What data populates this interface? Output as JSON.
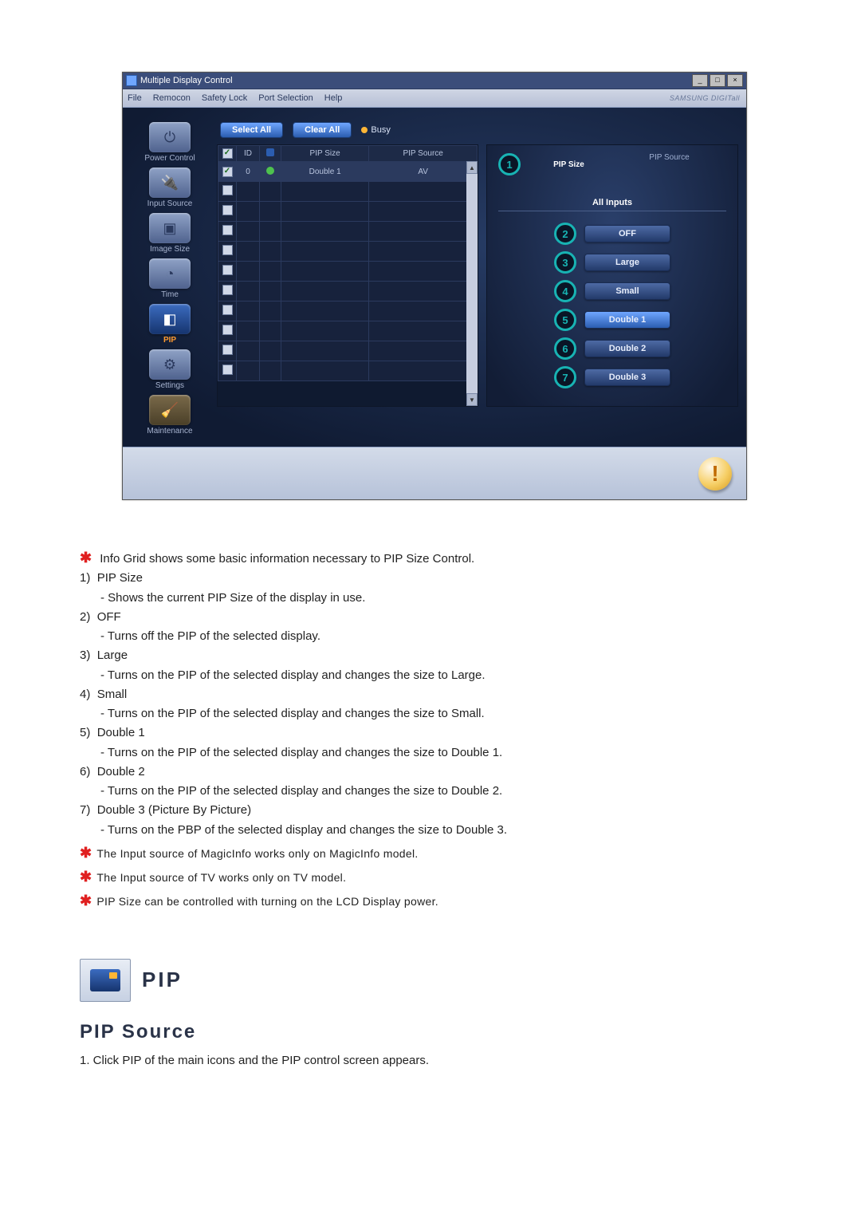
{
  "window": {
    "title": "Multiple Display Control",
    "menus": [
      "File",
      "Remocon",
      "Safety Lock",
      "Port Selection",
      "Help"
    ],
    "brand": "SAMSUNG DIGITall"
  },
  "sidebar": {
    "items": [
      "Power Control",
      "Input Source",
      "Image Size",
      "Time",
      "PIP",
      "Settings",
      "Maintenance"
    ]
  },
  "toolbar": {
    "select_all": "Select All",
    "clear_all": "Clear All",
    "busy": "Busy"
  },
  "grid": {
    "headers": {
      "id": "ID",
      "pip_size": "PIP Size",
      "pip_source": "PIP Source"
    },
    "row": {
      "id": "0",
      "pip_size": "Double 1",
      "pip_source": "AV"
    }
  },
  "panel": {
    "header": {
      "pip_size": "PIP Size",
      "pip_source": "PIP Source"
    },
    "subhead": "All Inputs",
    "options": [
      "OFF",
      "Large",
      "Small",
      "Double 1",
      "Double 2",
      "Double 3"
    ],
    "nums": [
      "1",
      "2",
      "3",
      "4",
      "5",
      "6",
      "7"
    ]
  },
  "doc": {
    "intro": "Info Grid shows some basic information necessary to PIP Size Control.",
    "items": [
      {
        "n": "1)",
        "t": "PIP Size",
        "d": "- Shows the current PIP Size of the display in use."
      },
      {
        "n": "2)",
        "t": "OFF",
        "d": "- Turns off the PIP of the selected display."
      },
      {
        "n": "3)",
        "t": "Large",
        "d": "- Turns on the PIP of the selected display and changes the size to Large."
      },
      {
        "n": "4)",
        "t": "Small",
        "d": "- Turns on the PIP of the selected display and changes the size to Small."
      },
      {
        "n": "5)",
        "t": "Double 1",
        "d": "- Turns on the PIP of the selected display and changes the size to Double 1."
      },
      {
        "n": "6)",
        "t": "Double 2",
        "d": "- Turns on the PIP of the selected display and changes the size to Double 2."
      },
      {
        "n": "7)",
        "t": "Double 3 (Picture By Picture)",
        "d": "- Turns on the PBP of the selected display and changes the size to Double 3."
      }
    ],
    "notes": [
      "The Input source of MagicInfo works only on MagicInfo model.",
      "The Input source of TV works only on TV model.",
      "PIP Size can be controlled with turning on the LCD Display power."
    ],
    "section_title": "PIP",
    "subsection_title": "PIP Source",
    "subsection_line": "1.  Click PIP of the main icons and the PIP control screen appears."
  }
}
